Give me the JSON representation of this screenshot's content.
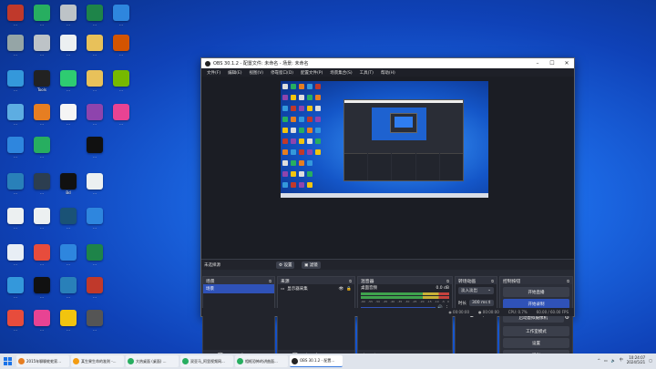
{
  "desktop": {
    "icons": [
      {
        "label": "…",
        "color": "#c0392b"
      },
      {
        "label": "…",
        "color": "#27ae60"
      },
      {
        "label": "…",
        "color": "#bdc3c7"
      },
      {
        "label": "…",
        "color": "#1e8449"
      },
      {
        "label": "…",
        "color": "#2e86de"
      },
      {
        "label": "…",
        "color": "#95a5a6"
      },
      {
        "label": "…",
        "color": "#ecf0f1"
      },
      {
        "label": "…",
        "color": "#e8c15a"
      },
      {
        "label": "…",
        "color": "#d35400"
      },
      {
        "label": "…",
        "color": "#bdc3c7"
      },
      {
        "label": "…",
        "color": "#3498db"
      },
      {
        "label": "Tools",
        "color": "#222"
      },
      {
        "label": "…",
        "color": "#2ecc71"
      },
      {
        "label": "…",
        "color": "#e8c15a"
      },
      {
        "label": "…",
        "color": "#76b900"
      },
      {
        "label": "…",
        "color": "#5dade2"
      },
      {
        "label": "…",
        "color": "#e67e22"
      },
      {
        "label": "…",
        "color": "#f5f5f5"
      },
      {
        "label": "…",
        "color": "#8e44ad"
      },
      {
        "label": "…",
        "color": "#e84393"
      },
      {
        "label": "…",
        "color": "#2e86de"
      },
      {
        "label": "…",
        "color": "#27ae60"
      },
      {
        "label": "…",
        "color": "#111"
      },
      {
        "label": "…",
        "color": "#2980b9"
      },
      {
        "label": "…",
        "color": "#2c3e50"
      },
      {
        "label": "Bd",
        "color": "#111"
      },
      {
        "label": "…",
        "color": "#ecf0f1"
      },
      {
        "label": "…",
        "color": "#ecf0f1"
      },
      {
        "label": "…",
        "color": "#ecf0f1"
      },
      {
        "label": "…",
        "color": "#1a5276"
      },
      {
        "label": "…",
        "color": "#2e86de"
      },
      {
        "label": "…",
        "color": "#e8eef5"
      },
      {
        "label": "…",
        "color": "#e74c3c"
      },
      {
        "label": "…",
        "color": "#2e86de"
      },
      {
        "label": "…",
        "color": "#1e8449"
      },
      {
        "label": "…",
        "color": "#3498db"
      },
      {
        "label": "…",
        "color": "#111"
      },
      {
        "label": "…",
        "color": "#2980b9"
      },
      {
        "label": "…",
        "color": "#c0392b"
      },
      {
        "label": "…",
        "color": "#e74c3c"
      },
      {
        "label": "…",
        "color": "#e84393"
      },
      {
        "label": "…",
        "color": "#f1c40f"
      },
      {
        "label": "…",
        "color": "#555"
      }
    ]
  },
  "obs": {
    "title": "OBS 30.1.2 - 配置文件: 未命名 - 场景: 未命名",
    "menu": [
      "文件(F)",
      "编辑(E)",
      "视图(V)",
      "停靠窗口(D)",
      "配置文件(P)",
      "场景集合(S)",
      "工具(T)",
      "帮助(H)"
    ],
    "scene_toolbar": {
      "label": "未选择源",
      "settings": "设置",
      "filters": "滤镜"
    },
    "docks": {
      "scenes": {
        "title": "场景",
        "items": [
          "场景"
        ]
      },
      "sources": {
        "title": "来源",
        "items": [
          "显示器采集"
        ]
      },
      "mixer": {
        "title": "混音器",
        "track": "桌面音频",
        "db": "0.0 dB",
        "scale": [
          "-60",
          "-55",
          "-50",
          "-45",
          "-40",
          "-35",
          "-30",
          "-25",
          "-20",
          "-15",
          "-10",
          "-5",
          "0"
        ]
      },
      "transitions": {
        "title": "转场动画",
        "type": "淡入淡出",
        "duration_label": "时长",
        "duration": "300 ms"
      },
      "controls": {
        "title": "控制按钮",
        "buttons": [
          "开始直播",
          "开始录制",
          "启动虚拟摄像机",
          "工作室模式",
          "设置",
          "退出"
        ]
      }
    },
    "status": {
      "live": "00:00:00",
      "rec": "00:00:00",
      "cpu": "CPU: 0.7%",
      "fps": "60.00 / 60.00 FPS"
    }
  },
  "taskbar": {
    "apps": [
      {
        "label": "2015年聊聊蛇蛇家...",
        "color": "#e67e22"
      },
      {
        "label": "某生果生命的准则 -...",
        "color": "#f39c12"
      },
      {
        "label": "大热桌面 (桌面) ...",
        "color": "#27ae60"
      },
      {
        "label": "双亚马_阿里视频网...",
        "color": "#27ae60"
      },
      {
        "label": "相框恐怖的讲曲面...",
        "color": "#27ae60"
      },
      {
        "label": "OBS 30.1.2 - 配置...",
        "color": "#222"
      }
    ],
    "time": "10:24:07",
    "date": "2024/5/21",
    "lang": "中"
  }
}
